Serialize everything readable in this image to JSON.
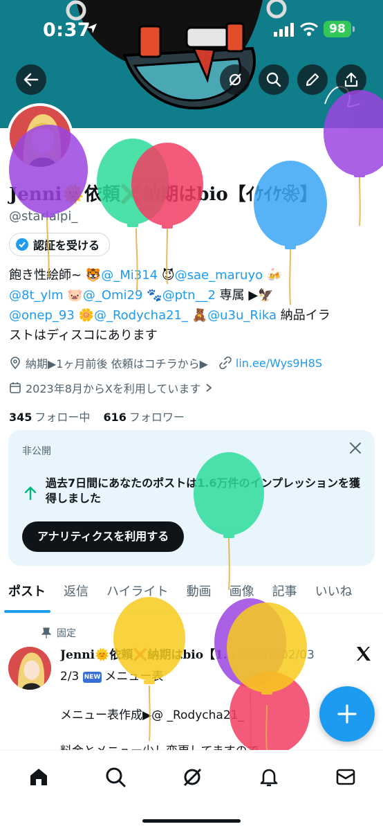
{
  "status": {
    "time": "0:37",
    "battery": "98"
  },
  "profile": {
    "name": "Jenni🌞依頼❌納期はbio【ｲｹｲｹ❀】",
    "handle": "@starlaipi_",
    "verify_label": "認証を受ける",
    "bio": {
      "l1_text": "飽き性絵師~ 🐯",
      "l1_m1": "@_Mi314",
      "l1_mid": " 😈",
      "l1_m2": "@sae_maruyo",
      "l1_end": " 🍻",
      "l2_m1": "@8t_ylm",
      "l2_mid1": " 🐷",
      "l2_m2": "@_Omi29",
      "l2_mid2": " 🐾",
      "l2_m3": "@ptn__2",
      "l2_end": " 専属 ▶︎🦅",
      "l3_m1": "@onep_93",
      "l3_mid1": " 🌼",
      "l3_m2": "@_Rodycha21_",
      "l3_mid2": " 🧸",
      "l3_m3": "@u3u_Rika",
      "l3_end": " 納品イラ",
      "l4_text": "ストはディスコにあります"
    },
    "location": "納期▶︎1ヶ月前後 依頼はコチラから▶︎",
    "link": "lin.ee/Wys9H8S",
    "joined": "2023年8月からXを利用しています",
    "following_count": "345",
    "following_label": "フォロー中",
    "followers_count": "616",
    "followers_label": "フォロワー"
  },
  "analytics_card": {
    "label": "非公開",
    "text": "過去7日間にあなたのポストは1.6万件のインプレッションを獲得しました",
    "button": "アナリティクスを利用する"
  },
  "tabs": [
    "ポスト",
    "返信",
    "ハイライト",
    "動画",
    "画像",
    "記事",
    "いいね"
  ],
  "post": {
    "pinned_label": "固定",
    "author": "Jenni🌞依頼❌納期はbio【1...",
    "date": "· 2026/02/03",
    "badge": "NEW",
    "line1_prefix": "2/3 ",
    "line1_text": "メニュー表",
    "line2": "メニュー表作成▶︎@ _Rodycha21_",
    "line3": "料金とメニュー少し変更してますので"
  },
  "icons": {
    "back": "back-arrow-icon",
    "grok": "grok-icon",
    "search": "search-icon",
    "edit": "pencil-icon",
    "share": "share-icon",
    "location": "location-pin-icon",
    "link": "link-icon",
    "calendar": "calendar-icon",
    "close": "close-icon",
    "trend": "arrow-up-icon",
    "pin": "pin-icon",
    "x": "x-logo-icon",
    "compose": "plus-icon",
    "home": "home-icon",
    "notifications": "bell-icon",
    "messages": "envelope-icon"
  },
  "colors": {
    "accent": "#1d9bf0",
    "banner": "#0f7d8a",
    "card_bg": "#e9f5fd",
    "battery": "#34c759"
  }
}
